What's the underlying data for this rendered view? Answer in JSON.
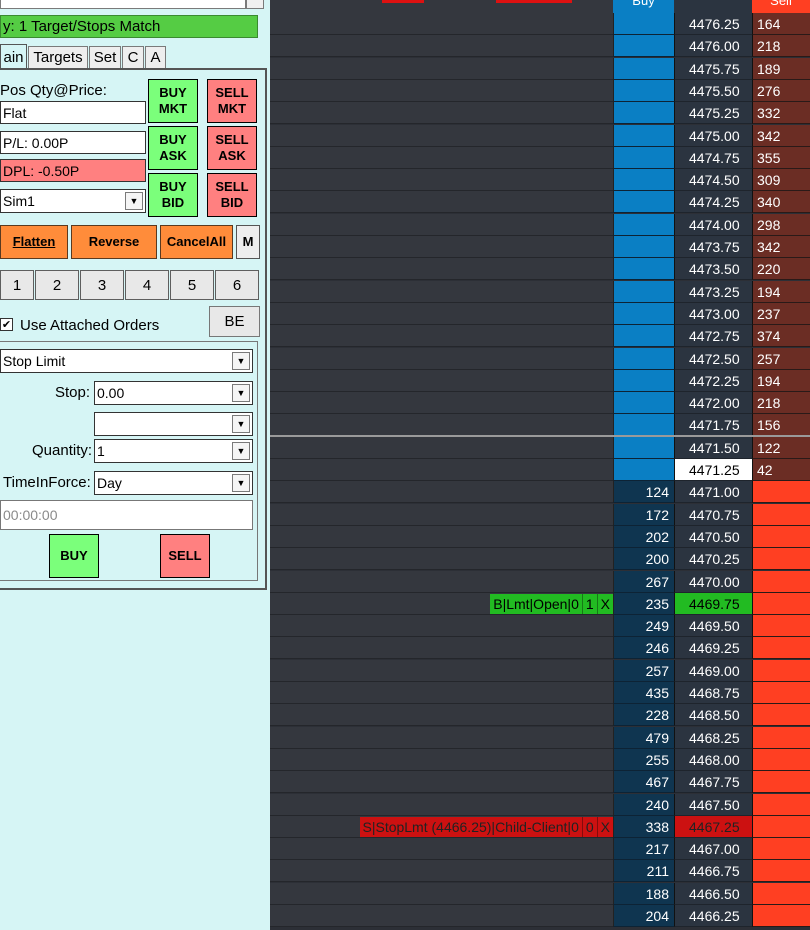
{
  "window": {
    "status_text": "y: 1 Target/Stops Match"
  },
  "tabs": [
    {
      "label": "ain"
    },
    {
      "label": "Targets"
    },
    {
      "label": "Set"
    },
    {
      "label": "C"
    },
    {
      "label": "A"
    }
  ],
  "position": {
    "header": "Pos Qty@Price:",
    "qty_price": "Flat",
    "pl": "P/L: 0.00P",
    "dpl": "DPL: -0.50P",
    "account": "Sim1"
  },
  "market_buttons": {
    "buy_mkt": "BUY\nMKT",
    "sell_mkt": "SELL\nMKT",
    "buy_ask": "BUY\nASK",
    "sell_ask": "SELL\nASK",
    "buy_bid": "BUY\nBID",
    "sell_bid": "SELL\nBID"
  },
  "actions": {
    "flatten": "Flatten",
    "reverse": "Reverse",
    "cancel_all": "CancelAll",
    "m": "M"
  },
  "quantity_presets": [
    "1",
    "2",
    "3",
    "4",
    "5",
    "6"
  ],
  "attached": {
    "label": "Use Attached Orders",
    "checked": true,
    "be_label": "BE"
  },
  "order_entry": {
    "order_type": "Stop Limit",
    "stop_label": "Stop:",
    "stop_value": "0.00",
    "extra_value": "",
    "quantity_label": "Quantity:",
    "quantity_value": "1",
    "tif_label": "TimeInForce:",
    "tif_value": "Day",
    "time_value": "00:00:00",
    "buy_label": "BUY",
    "sell_label": "SELL"
  },
  "ladder": {
    "buy_header": "Buy",
    "sell_header": "Sell",
    "colors": {
      "bid_blue": "#0a7fc4",
      "bid_dark": "#0f3550",
      "ask_brown": "#6b2d24",
      "ask_red": "#ff3f22",
      "order_green": "#22bb22",
      "order_red": "#cc1111"
    },
    "rows": [
      {
        "price": "4476.25",
        "sell": "164"
      },
      {
        "price": "4476.00",
        "sell": "218"
      },
      {
        "price": "4475.75",
        "sell": "189"
      },
      {
        "price": "4475.50",
        "sell": "276"
      },
      {
        "price": "4475.25",
        "sell": "332"
      },
      {
        "price": "4475.00",
        "sell": "342"
      },
      {
        "price": "4474.75",
        "sell": "355"
      },
      {
        "price": "4474.50",
        "sell": "309"
      },
      {
        "price": "4474.25",
        "sell": "340"
      },
      {
        "price": "4474.00",
        "sell": "298"
      },
      {
        "price": "4473.75",
        "sell": "342"
      },
      {
        "price": "4473.50",
        "sell": "220"
      },
      {
        "price": "4473.25",
        "sell": "194"
      },
      {
        "price": "4473.00",
        "sell": "237"
      },
      {
        "price": "4472.75",
        "sell": "374"
      },
      {
        "price": "4472.50",
        "sell": "257"
      },
      {
        "price": "4472.25",
        "sell": "194"
      },
      {
        "price": "4472.00",
        "sell": "218"
      },
      {
        "price": "4471.75",
        "sell": "156"
      },
      {
        "price": "4471.50",
        "sell": "122"
      },
      {
        "price": "4471.25",
        "sell": "42",
        "last": true
      },
      {
        "price": "4471.00",
        "buy": "124"
      },
      {
        "price": "4470.75",
        "buy": "172"
      },
      {
        "price": "4470.50",
        "buy": "202"
      },
      {
        "price": "4470.25",
        "buy": "200"
      },
      {
        "price": "4470.00",
        "buy": "267"
      },
      {
        "price": "4469.75",
        "buy": "235",
        "order": "buy"
      },
      {
        "price": "4469.50",
        "buy": "249"
      },
      {
        "price": "4469.25",
        "buy": "246"
      },
      {
        "price": "4469.00",
        "buy": "257"
      },
      {
        "price": "4468.75",
        "buy": "435"
      },
      {
        "price": "4468.50",
        "buy": "228"
      },
      {
        "price": "4468.25",
        "buy": "479"
      },
      {
        "price": "4468.00",
        "buy": "255"
      },
      {
        "price": "4467.75",
        "buy": "467"
      },
      {
        "price": "4467.50",
        "buy": "240"
      },
      {
        "price": "4467.25",
        "buy": "338",
        "order": "sell"
      },
      {
        "price": "4467.00",
        "buy": "217"
      },
      {
        "price": "4466.75",
        "buy": "211"
      },
      {
        "price": "4466.50",
        "buy": "188"
      },
      {
        "price": "4466.25",
        "buy": "204"
      }
    ],
    "working_orders": {
      "buy": {
        "text": "B|Lmt|Open|0",
        "filled": "1",
        "cancel": "X"
      },
      "sell": {
        "text": "S|StopLmt (4466.25)|Child-Client|0",
        "filled": "0",
        "cancel": "X"
      }
    }
  }
}
